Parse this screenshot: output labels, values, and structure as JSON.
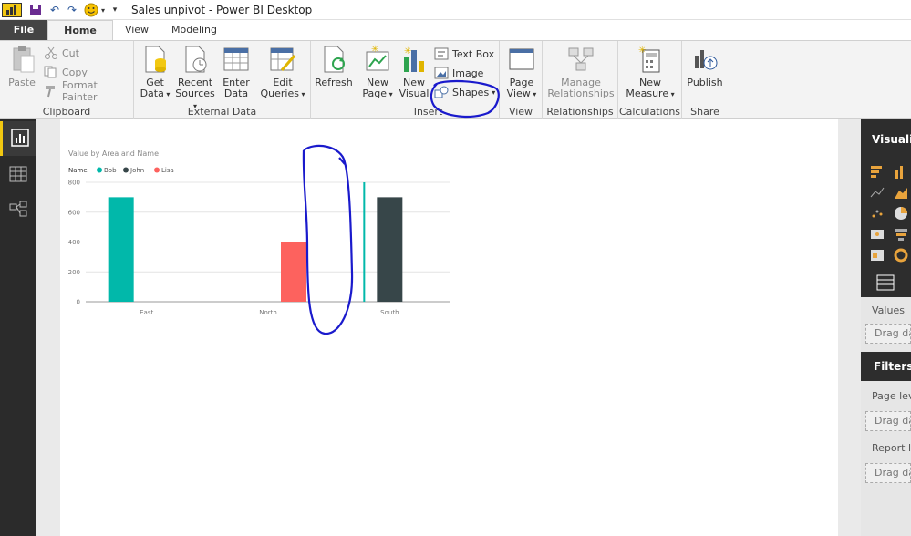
{
  "window": {
    "title": "Sales unpivot - Power BI Desktop"
  },
  "tabs": {
    "file": "File",
    "home": "Home",
    "view": "View",
    "modeling": "Modeling"
  },
  "ribbon": {
    "clipboard": {
      "paste": "Paste",
      "cut": "Cut",
      "copy": "Copy",
      "format_painter": "Format Painter",
      "label": "Clipboard"
    },
    "external_data": {
      "get_data_1": "Get",
      "get_data_2": "Data",
      "recent_1": "Recent",
      "recent_2": "Sources",
      "enter_1": "Enter",
      "enter_2": "Data",
      "edit_1": "Edit",
      "edit_2": "Queries",
      "label": "External Data"
    },
    "refresh": "Refresh",
    "insert": {
      "new_page_1": "New",
      "new_page_2": "Page",
      "new_visual_1": "New",
      "new_visual_2": "Visual",
      "text_box": "Text Box",
      "image": "Image",
      "shapes": "Shapes",
      "label": "Insert"
    },
    "view": {
      "page_view_1": "Page",
      "page_view_2": "View",
      "label": "View"
    },
    "relationships": {
      "manage_1": "Manage",
      "manage_2": "Relationships",
      "label": "Relationships"
    },
    "calculations": {
      "new_measure_1": "New",
      "new_measure_2": "Measure",
      "label": "Calculations"
    },
    "share": {
      "publish": "Publish",
      "label": "Share"
    }
  },
  "right_pane": {
    "visualizations": "Visualiz",
    "values": "Values",
    "drag_data": "Drag da",
    "filters": "Filters",
    "page_level": "Page lev",
    "drag_data_2": "Drag dat",
    "report_level": "Report le",
    "drag_data_3": "Drag dat"
  },
  "colors": {
    "bob": "#01B8AA",
    "john": "#374649",
    "lisa": "#FD625E",
    "annotation": "#1a1acc"
  },
  "chart_data": {
    "type": "bar",
    "title": "Value by Area and Name",
    "legend_title": "Name",
    "categories": [
      "East",
      "North",
      "South"
    ],
    "series": [
      {
        "name": "Bob",
        "values": [
          700,
          null,
          800
        ]
      },
      {
        "name": "John",
        "values": [
          null,
          null,
          700
        ]
      },
      {
        "name": "Lisa",
        "values": [
          null,
          400,
          null
        ]
      }
    ],
    "yticks": [
      "800",
      "600",
      "400",
      "200",
      "0"
    ],
    "ylim": [
      0,
      800
    ]
  }
}
